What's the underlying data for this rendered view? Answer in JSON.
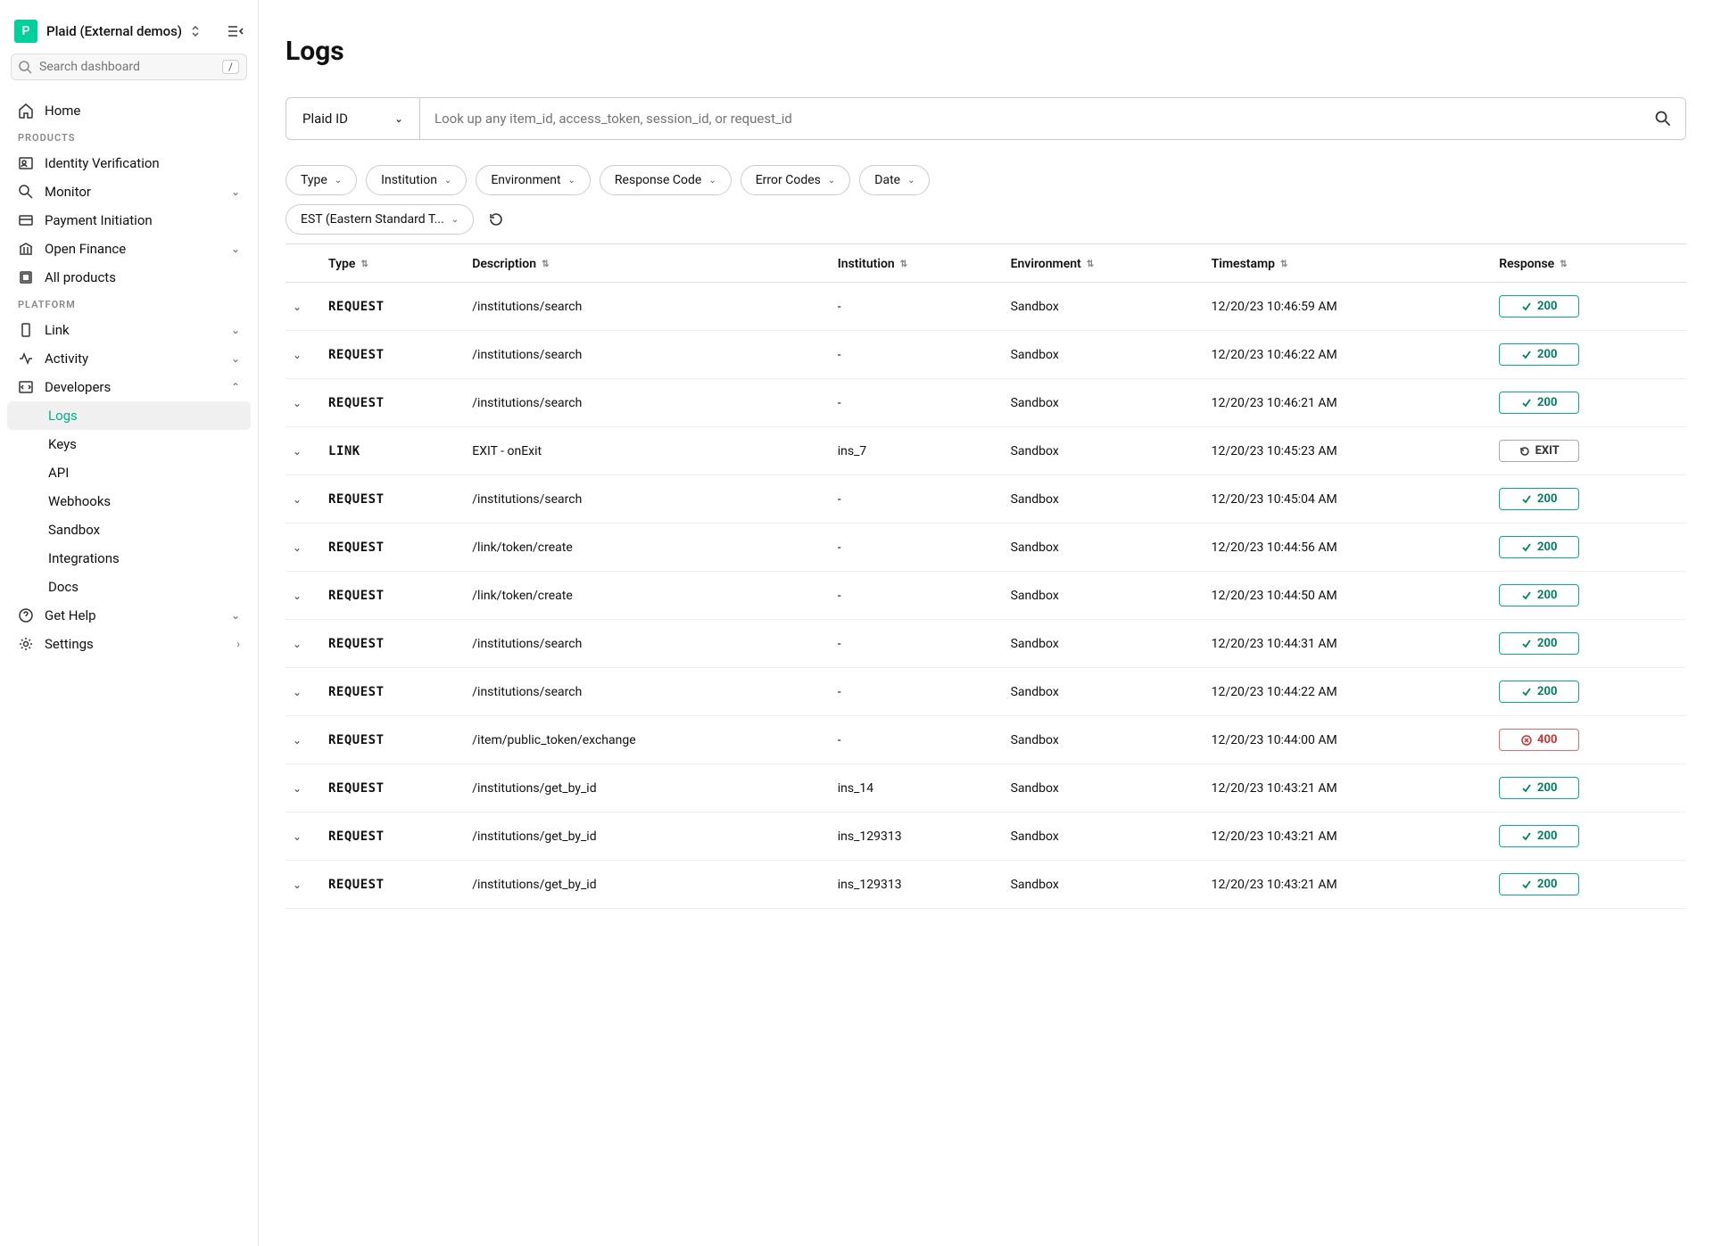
{
  "workspace": {
    "badge": "P",
    "name": "Plaid (External demos)"
  },
  "search": {
    "placeholder": "Search dashboard",
    "key": "/"
  },
  "sections": {
    "products_label": "PRODUCTS",
    "platform_label": "PLATFORM"
  },
  "nav": {
    "home": "Home",
    "identity": "Identity Verification",
    "monitor": "Monitor",
    "payment": "Payment Initiation",
    "openfin": "Open Finance",
    "allprod": "All products",
    "link": "Link",
    "activity": "Activity",
    "developers": "Developers",
    "dev_children": {
      "logs": "Logs",
      "keys": "Keys",
      "api": "API",
      "webhooks": "Webhooks",
      "sandbox": "Sandbox",
      "integrations": "Integrations",
      "docs": "Docs"
    },
    "gethelp": "Get Help",
    "settings": "Settings"
  },
  "page": {
    "title": "Logs",
    "search_type": "Plaid ID",
    "search_placeholder": "Look up any item_id, access_token, session_id, or request_id"
  },
  "filters": {
    "type": "Type",
    "institution": "Institution",
    "environment": "Environment",
    "response": "Response Code",
    "errors": "Error Codes",
    "date": "Date",
    "tz": "EST (Eastern Standard T..."
  },
  "columns": {
    "type": "Type",
    "description": "Description",
    "institution": "Institution",
    "environment": "Environment",
    "timestamp": "Timestamp",
    "response": "Response"
  },
  "rows": [
    {
      "type": "REQUEST",
      "desc": "/institutions/search",
      "inst": "-",
      "env": "Sandbox",
      "ts": "12/20/23 10:46:59 AM",
      "resp": "200",
      "rk": "200"
    },
    {
      "type": "REQUEST",
      "desc": "/institutions/search",
      "inst": "-",
      "env": "Sandbox",
      "ts": "12/20/23 10:46:22 AM",
      "resp": "200",
      "rk": "200"
    },
    {
      "type": "REQUEST",
      "desc": "/institutions/search",
      "inst": "-",
      "env": "Sandbox",
      "ts": "12/20/23 10:46:21 AM",
      "resp": "200",
      "rk": "200"
    },
    {
      "type": "LINK",
      "desc": "EXIT - onExit",
      "inst": "ins_7",
      "env": "Sandbox",
      "ts": "12/20/23 10:45:23 AM",
      "resp": "EXIT",
      "rk": "exit"
    },
    {
      "type": "REQUEST",
      "desc": "/institutions/search",
      "inst": "-",
      "env": "Sandbox",
      "ts": "12/20/23 10:45:04 AM",
      "resp": "200",
      "rk": "200"
    },
    {
      "type": "REQUEST",
      "desc": "/link/token/create",
      "inst": "-",
      "env": "Sandbox",
      "ts": "12/20/23 10:44:56 AM",
      "resp": "200",
      "rk": "200"
    },
    {
      "type": "REQUEST",
      "desc": "/link/token/create",
      "inst": "-",
      "env": "Sandbox",
      "ts": "12/20/23 10:44:50 AM",
      "resp": "200",
      "rk": "200"
    },
    {
      "type": "REQUEST",
      "desc": "/institutions/search",
      "inst": "-",
      "env": "Sandbox",
      "ts": "12/20/23 10:44:31 AM",
      "resp": "200",
      "rk": "200"
    },
    {
      "type": "REQUEST",
      "desc": "/institutions/search",
      "inst": "-",
      "env": "Sandbox",
      "ts": "12/20/23 10:44:22 AM",
      "resp": "200",
      "rk": "200"
    },
    {
      "type": "REQUEST",
      "desc": "/item/public_token/exchange",
      "inst": "-",
      "env": "Sandbox",
      "ts": "12/20/23 10:44:00 AM",
      "resp": "400",
      "rk": "400"
    },
    {
      "type": "REQUEST",
      "desc": "/institutions/get_by_id",
      "inst": "ins_14",
      "env": "Sandbox",
      "ts": "12/20/23 10:43:21 AM",
      "resp": "200",
      "rk": "200"
    },
    {
      "type": "REQUEST",
      "desc": "/institutions/get_by_id",
      "inst": "ins_129313",
      "env": "Sandbox",
      "ts": "12/20/23 10:43:21 AM",
      "resp": "200",
      "rk": "200"
    },
    {
      "type": "REQUEST",
      "desc": "/institutions/get_by_id",
      "inst": "ins_129313",
      "env": "Sandbox",
      "ts": "12/20/23 10:43:21 AM",
      "resp": "200",
      "rk": "200"
    }
  ]
}
